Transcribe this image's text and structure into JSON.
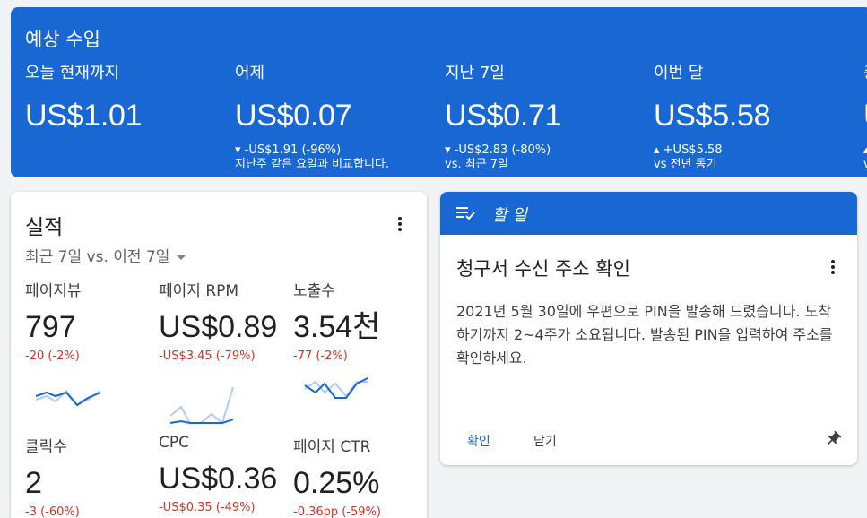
{
  "earnings": {
    "title": "예상 수입",
    "metrics": [
      {
        "label": "오늘 현재까지",
        "value": "US$1.01",
        "change": "",
        "sub": ""
      },
      {
        "label": "어제",
        "value": "US$0.07",
        "change": "▾ -US$1.91 (-96%)",
        "sub": "지난주 같은 요일과 비교합니다."
      },
      {
        "label": "지난 7일",
        "value": "US$0.71",
        "change": "▾ -US$2.83 (-80%)",
        "sub": "vs. 최근 7일"
      },
      {
        "label": "이번 달",
        "value": "US$5.58",
        "change": "▴ +US$5.58",
        "sub": "vs 전년 동기"
      },
      {
        "label": "총",
        "value": "U",
        "change": "▴",
        "sub": "v"
      }
    ]
  },
  "performance": {
    "title": "실적",
    "range": "최근 7일 vs. 이전 7일",
    "stats": [
      {
        "label": "페이지뷰",
        "value": "797",
        "change": "-20 (-2%)"
      },
      {
        "label": "페이지 RPM",
        "value": "US$0.89",
        "change": "-US$3.45 (-79%)"
      },
      {
        "label": "노출수",
        "value": "3.54천",
        "change": "-77 (-2%)"
      },
      {
        "label": "클릭수",
        "value": "2",
        "change": "-3 (-60%)"
      },
      {
        "label": "CPC",
        "value": "US$0.36",
        "change": "-US$0.35 (-49%)"
      },
      {
        "label": "페이지 CTR",
        "value": "0.25%",
        "change": "-0.36pp (-59%)"
      }
    ]
  },
  "todo": {
    "header": "할 일",
    "title": "청구서 수신 주소 확인",
    "body": "2021년 5월 30일에 우편으로 PIN을 발송해 드렸습니다. 도착하기까지 2~4주가 소요됩니다. 발송된 PIN을 입력하여 주소를 확인하세요.",
    "confirm_label": "확인",
    "close_label": "닫기"
  },
  "colors": {
    "primary": "#1967d2",
    "negative": "#d93025",
    "spark_current": "#1967d2",
    "spark_previous": "#aecbfa"
  },
  "icons": [
    "more-vert-icon",
    "playlist-check-icon",
    "pin-icon",
    "dropdown-caret-icon"
  ]
}
